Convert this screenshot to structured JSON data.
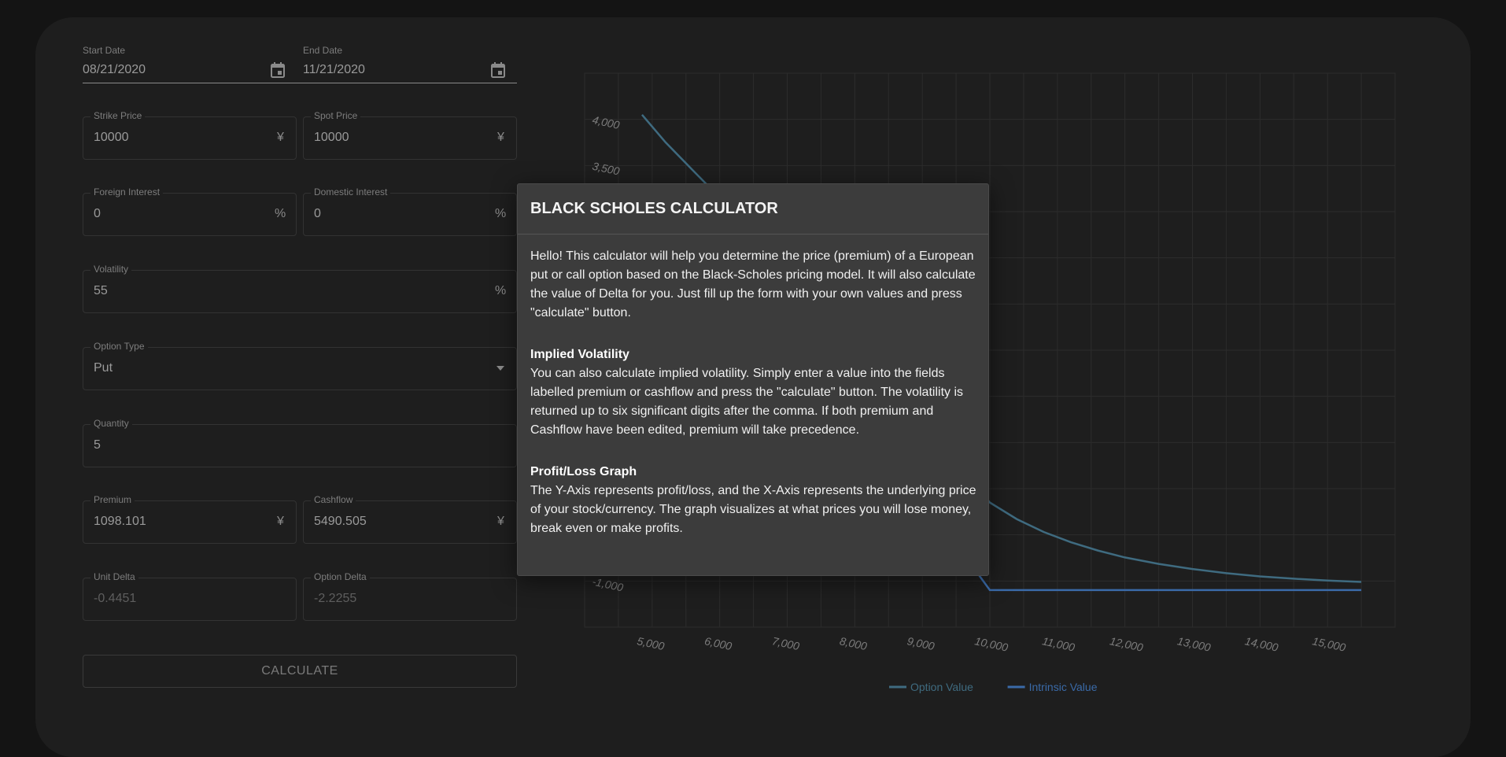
{
  "form": {
    "start_date": {
      "label": "Start Date",
      "value": "08/21/2020"
    },
    "end_date": {
      "label": "End Date",
      "value": "11/21/2020"
    },
    "strike_price": {
      "label": "Strike Price",
      "value": "10000",
      "unit": "¥"
    },
    "spot_price": {
      "label": "Spot Price",
      "value": "10000",
      "unit": "¥"
    },
    "foreign_interest": {
      "label": "Foreign Interest",
      "value": "0",
      "unit": "%"
    },
    "domestic_interest": {
      "label": "Domestic Interest",
      "value": "0",
      "unit": "%"
    },
    "volatility": {
      "label": "Volatility",
      "value": "55",
      "unit": "%"
    },
    "option_type": {
      "label": "Option Type",
      "value": "Put"
    },
    "quantity": {
      "label": "Quantity",
      "value": "5"
    },
    "premium": {
      "label": "Premium",
      "value": "1098.101",
      "unit": "¥"
    },
    "cashflow": {
      "label": "Cashflow",
      "value": "5490.505",
      "unit": "¥"
    },
    "unit_delta": {
      "label": "Unit Delta",
      "value": "-0.4451"
    },
    "option_delta": {
      "label": "Option Delta",
      "value": "-2.2255"
    },
    "calculate_label": "CALCULATE"
  },
  "chart_data": {
    "type": "line",
    "x_ticks": [
      "5,000",
      "6,000",
      "7,000",
      "8,000",
      "9,000",
      "10,000",
      "11,000",
      "12,000",
      "13,000",
      "14,000",
      "15,000"
    ],
    "y_ticks": [
      "4,000",
      "3,500",
      "-1,000"
    ],
    "xlim": [
      4000,
      16000
    ],
    "ylim": [
      -1500,
      4500
    ],
    "series": [
      {
        "name": "Option Value",
        "color": "#3f6b80",
        "x": [
          4850,
          5200,
          5600,
          6000,
          6500,
          10000,
          10400,
          10800,
          11200,
          11600,
          12000,
          12500,
          13000,
          13500,
          14000,
          14500,
          15000,
          15500
        ],
        "y": [
          4050,
          3750,
          3450,
          3150,
          2800,
          -150,
          -330,
          -470,
          -580,
          -670,
          -745,
          -815,
          -870,
          -915,
          -950,
          -975,
          -995,
          -1010
        ]
      },
      {
        "name": "Intrinsic Value",
        "color": "#3a6aa8",
        "x": [
          9000,
          10000,
          15500
        ],
        "y": [
          -95,
          -1098,
          -1098
        ]
      }
    ]
  },
  "modal": {
    "title": "BLACK SCHOLES CALCULATOR",
    "intro": "Hello! This calculator will help you determine the price (premium) of a European put or call option based on the Black-Scholes pricing model. It will also calculate the value of Delta for you. Just fill up the form with your own values and press \"calculate\" button.",
    "iv_heading": "Implied Volatility",
    "iv_text": "You can also calculate implied volatility. Simply enter a value into the fields labelled premium or cashflow and press the \"calculate\" button. The volatility is returned up to six significant digits after the comma. If both premium and Cashflow have been edited, premium will take precedence.",
    "pl_heading": "Profit/Loss Graph",
    "pl_text": "The Y-Axis represents profit/loss, and the X-Axis represents the underlying price of your stock/currency. The graph visualizes at what prices you will lose money, break even or make profits."
  }
}
